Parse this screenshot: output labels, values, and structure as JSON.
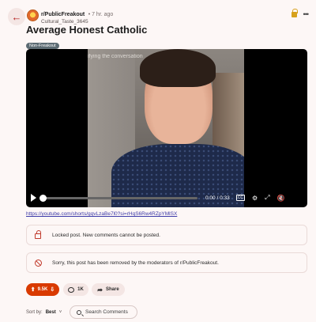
{
  "header": {
    "back_icon": "arrow-left-icon",
    "subreddit": "r/PublicFreakout",
    "time_ago": "• 7 hr. ago",
    "author": "Cultural_Taste_3645",
    "title": "Average Honest Catholic",
    "flair": "Non-Freakout"
  },
  "video": {
    "caption": "ifying the conversation",
    "progress": 0,
    "time": "0:00 / 0:33",
    "cc_label": "CC"
  },
  "post": {
    "link": "https://youtube.com/shorts/gqvLzaBe7l0?si=rHqS6Rw4RZpYMlSX"
  },
  "notices": {
    "locked": "Locked post. New comments cannot be posted.",
    "removed": "Sorry, this post has been removed by the moderators of r/PublicFreakout."
  },
  "actions": {
    "votes": "9.5K",
    "comments": "1K",
    "share": "Share"
  },
  "sort": {
    "label": "Sort by:",
    "value": "Best",
    "search_placeholder": "Search Comments"
  },
  "colors": {
    "accent": "#d93a00",
    "background": "#fdf7f6",
    "link": "#3d3aa8"
  }
}
